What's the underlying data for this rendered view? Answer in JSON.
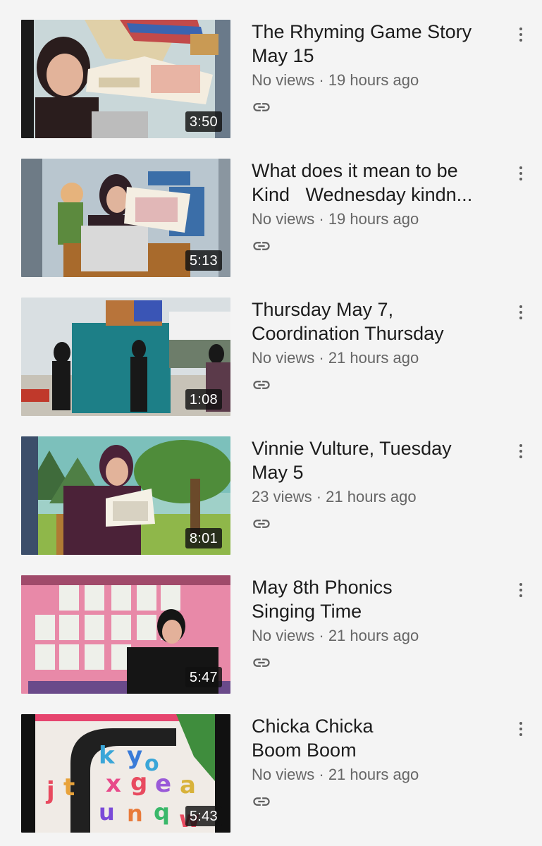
{
  "videos": [
    {
      "title": "The Rhyming Game Story\nMay 15",
      "views": "No views",
      "age": "19 hours ago",
      "duration": "3:50",
      "thumb": "rhyming-book-reading"
    },
    {
      "title": "What does it mean to be\nKind   Wednesday kindn...",
      "views": "No views",
      "age": "19 hours ago",
      "duration": "5:13",
      "thumb": "kindness-book-reading"
    },
    {
      "title": "Thursday May 7,\nCoordination Thursday",
      "views": "No views",
      "age": "21 hours ago",
      "duration": "1:08",
      "thumb": "gym-coordination"
    },
    {
      "title": "Vinnie Vulture, Tuesday\nMay 5",
      "views": "23 views",
      "age": "21 hours ago",
      "duration": "8:01",
      "thumb": "forest-book-reading"
    },
    {
      "title": "May 8th Phonics\nSinging Time",
      "views": "No views",
      "age": "21 hours ago",
      "duration": "5:47",
      "thumb": "phonics-wall"
    },
    {
      "title": "Chicka Chicka\nBoom Boom",
      "views": "No views",
      "age": "21 hours ago",
      "duration": "5:43",
      "thumb": "alphabet-tree"
    }
  ],
  "separator": " · ",
  "icons": {
    "link": "link-icon",
    "more": "more-vert-icon"
  },
  "colors": {
    "background": "#f4f4f4",
    "title": "#1c1c1c",
    "subtext": "#666666",
    "duration_bg": "#111111"
  }
}
